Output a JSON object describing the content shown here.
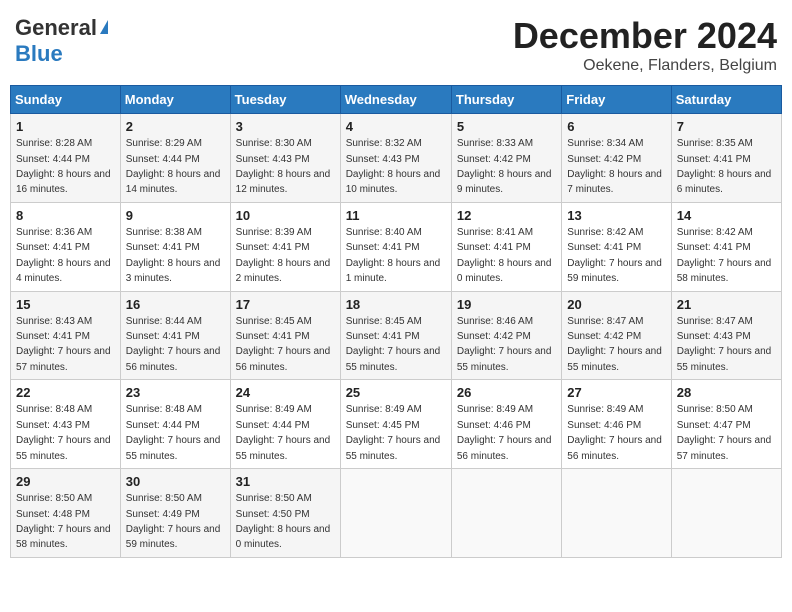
{
  "header": {
    "logo_general": "General",
    "logo_blue": "Blue",
    "title": "December 2024",
    "location": "Oekene, Flanders, Belgium"
  },
  "calendar": {
    "days_of_week": [
      "Sunday",
      "Monday",
      "Tuesday",
      "Wednesday",
      "Thursday",
      "Friday",
      "Saturday"
    ],
    "weeks": [
      [
        {
          "day": "1",
          "sunrise": "8:28 AM",
          "sunset": "4:44 PM",
          "daylight": "8 hours and 16 minutes."
        },
        {
          "day": "2",
          "sunrise": "8:29 AM",
          "sunset": "4:44 PM",
          "daylight": "8 hours and 14 minutes."
        },
        {
          "day": "3",
          "sunrise": "8:30 AM",
          "sunset": "4:43 PM",
          "daylight": "8 hours and 12 minutes."
        },
        {
          "day": "4",
          "sunrise": "8:32 AM",
          "sunset": "4:43 PM",
          "daylight": "8 hours and 10 minutes."
        },
        {
          "day": "5",
          "sunrise": "8:33 AM",
          "sunset": "4:42 PM",
          "daylight": "8 hours and 9 minutes."
        },
        {
          "day": "6",
          "sunrise": "8:34 AM",
          "sunset": "4:42 PM",
          "daylight": "8 hours and 7 minutes."
        },
        {
          "day": "7",
          "sunrise": "8:35 AM",
          "sunset": "4:41 PM",
          "daylight": "8 hours and 6 minutes."
        }
      ],
      [
        {
          "day": "8",
          "sunrise": "8:36 AM",
          "sunset": "4:41 PM",
          "daylight": "8 hours and 4 minutes."
        },
        {
          "day": "9",
          "sunrise": "8:38 AM",
          "sunset": "4:41 PM",
          "daylight": "8 hours and 3 minutes."
        },
        {
          "day": "10",
          "sunrise": "8:39 AM",
          "sunset": "4:41 PM",
          "daylight": "8 hours and 2 minutes."
        },
        {
          "day": "11",
          "sunrise": "8:40 AM",
          "sunset": "4:41 PM",
          "daylight": "8 hours and 1 minute."
        },
        {
          "day": "12",
          "sunrise": "8:41 AM",
          "sunset": "4:41 PM",
          "daylight": "8 hours and 0 minutes."
        },
        {
          "day": "13",
          "sunrise": "8:42 AM",
          "sunset": "4:41 PM",
          "daylight": "7 hours and 59 minutes."
        },
        {
          "day": "14",
          "sunrise": "8:42 AM",
          "sunset": "4:41 PM",
          "daylight": "7 hours and 58 minutes."
        }
      ],
      [
        {
          "day": "15",
          "sunrise": "8:43 AM",
          "sunset": "4:41 PM",
          "daylight": "7 hours and 57 minutes."
        },
        {
          "day": "16",
          "sunrise": "8:44 AM",
          "sunset": "4:41 PM",
          "daylight": "7 hours and 56 minutes."
        },
        {
          "day": "17",
          "sunrise": "8:45 AM",
          "sunset": "4:41 PM",
          "daylight": "7 hours and 56 minutes."
        },
        {
          "day": "18",
          "sunrise": "8:45 AM",
          "sunset": "4:41 PM",
          "daylight": "7 hours and 55 minutes."
        },
        {
          "day": "19",
          "sunrise": "8:46 AM",
          "sunset": "4:42 PM",
          "daylight": "7 hours and 55 minutes."
        },
        {
          "day": "20",
          "sunrise": "8:47 AM",
          "sunset": "4:42 PM",
          "daylight": "7 hours and 55 minutes."
        },
        {
          "day": "21",
          "sunrise": "8:47 AM",
          "sunset": "4:43 PM",
          "daylight": "7 hours and 55 minutes."
        }
      ],
      [
        {
          "day": "22",
          "sunrise": "8:48 AM",
          "sunset": "4:43 PM",
          "daylight": "7 hours and 55 minutes."
        },
        {
          "day": "23",
          "sunrise": "8:48 AM",
          "sunset": "4:44 PM",
          "daylight": "7 hours and 55 minutes."
        },
        {
          "day": "24",
          "sunrise": "8:49 AM",
          "sunset": "4:44 PM",
          "daylight": "7 hours and 55 minutes."
        },
        {
          "day": "25",
          "sunrise": "8:49 AM",
          "sunset": "4:45 PM",
          "daylight": "7 hours and 55 minutes."
        },
        {
          "day": "26",
          "sunrise": "8:49 AM",
          "sunset": "4:46 PM",
          "daylight": "7 hours and 56 minutes."
        },
        {
          "day": "27",
          "sunrise": "8:49 AM",
          "sunset": "4:46 PM",
          "daylight": "7 hours and 56 minutes."
        },
        {
          "day": "28",
          "sunrise": "8:50 AM",
          "sunset": "4:47 PM",
          "daylight": "7 hours and 57 minutes."
        }
      ],
      [
        {
          "day": "29",
          "sunrise": "8:50 AM",
          "sunset": "4:48 PM",
          "daylight": "7 hours and 58 minutes."
        },
        {
          "day": "30",
          "sunrise": "8:50 AM",
          "sunset": "4:49 PM",
          "daylight": "7 hours and 59 minutes."
        },
        {
          "day": "31",
          "sunrise": "8:50 AM",
          "sunset": "4:50 PM",
          "daylight": "8 hours and 0 minutes."
        },
        null,
        null,
        null,
        null
      ]
    ]
  }
}
